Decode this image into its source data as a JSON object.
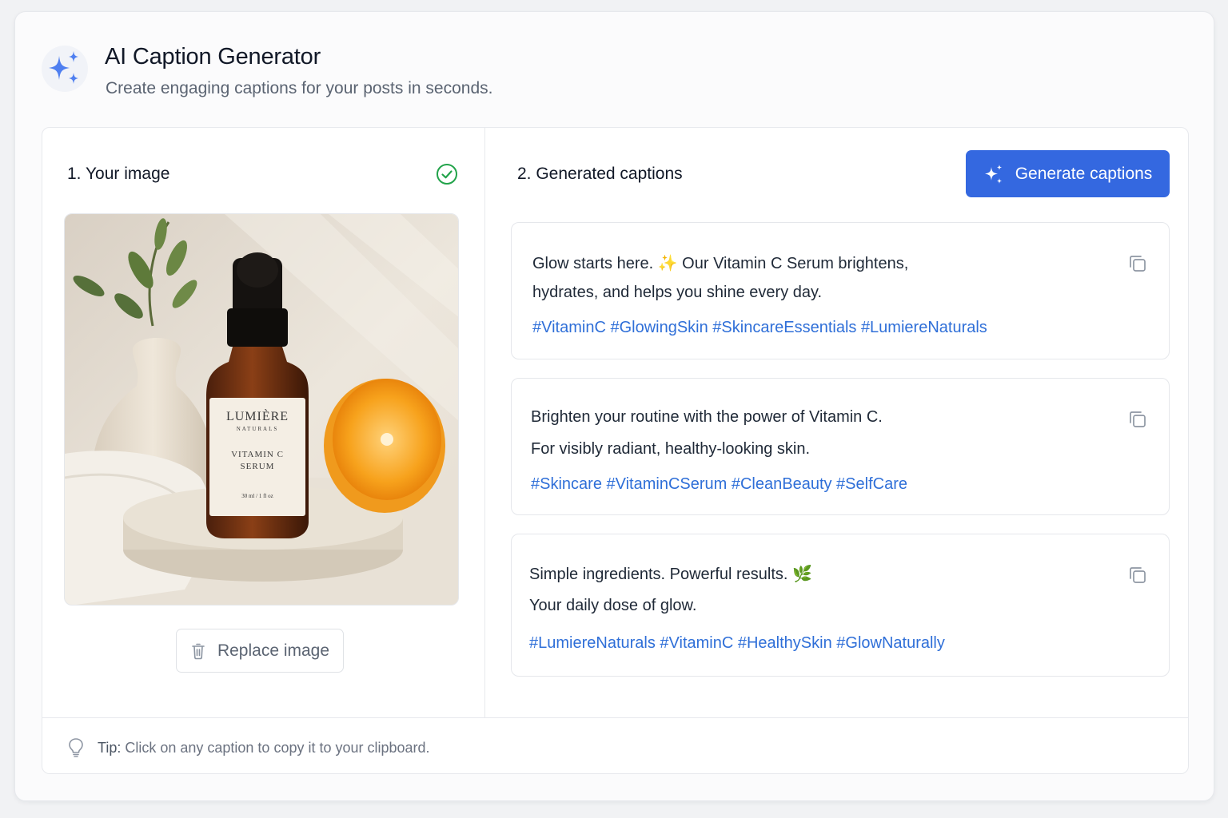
{
  "app": {
    "title": "AI Caption Generator",
    "subtitle": "Create engaging captions for your posts in seconds.",
    "logo_icon": "sparkles-icon"
  },
  "image_section": {
    "title": "1. Your image",
    "status_icon": "check-circle-icon",
    "product": {
      "brand": "LUMIÈRE",
      "brand_sub": "NATURALS",
      "name_line1": "VITAMIN C",
      "name_line2": "SERUM",
      "size": "30 ml / 1 fl oz"
    },
    "replace_label": "Replace image",
    "replace_icon": "trash-icon"
  },
  "captions_section": {
    "title": "2. Generated captions",
    "generate_label": "Generate captions",
    "generate_icon": "sparkles-icon",
    "copy_icon": "copy-icon",
    "captions": [
      {
        "line1": "Glow starts here. ✨ Our Vitamin C Serum brightens,",
        "line2": "hydrates, and helps you shine every day.",
        "tags": "#VitaminC #GlowingSkin #SkincareEssentials #LumiereNaturals"
      },
      {
        "line1": "Brighten your routine with the power of Vitamin C.",
        "line2": "For visibly radiant, healthy-looking skin.",
        "tags": "#Skincare #VitaminCSerum #CleanBeauty #SelfCare"
      },
      {
        "line1": "Simple ingredients. Powerful results. 🌿",
        "line2": "Your daily dose of glow.",
        "tags": "#LumiereNaturals #VitaminC #HealthySkin #GlowNaturally"
      }
    ]
  },
  "tip": {
    "label": "Tip:",
    "text": " Click on any caption to copy it to your clipboard.",
    "icon": "lightbulb-icon"
  },
  "colors": {
    "accent": "#3468e0",
    "hashtag": "#2f6fd8",
    "success": "#22a34a"
  }
}
